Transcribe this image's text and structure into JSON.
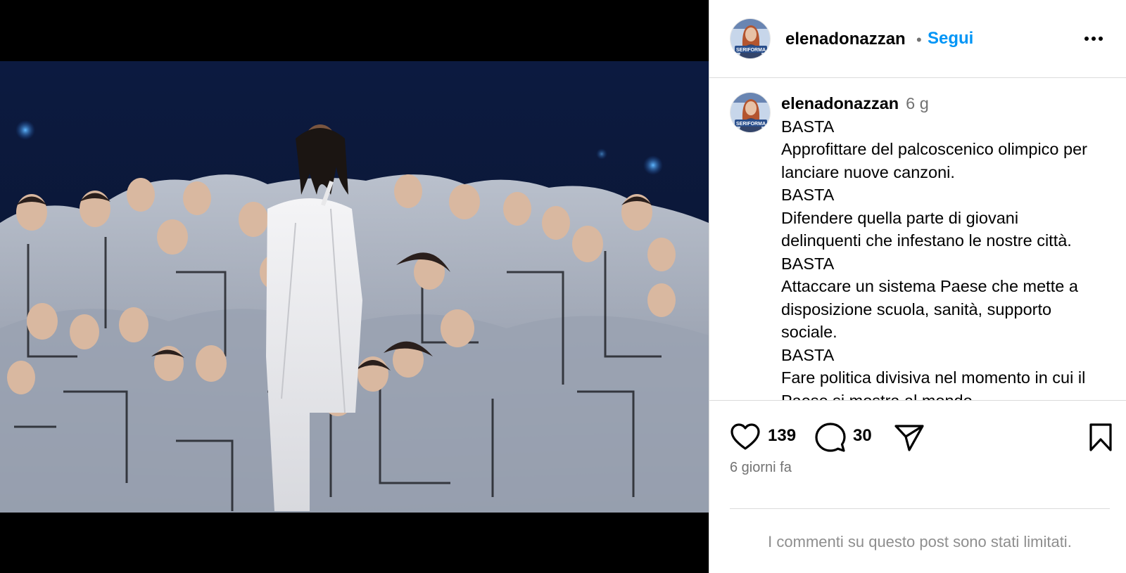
{
  "header": {
    "username": "elenadonazzan",
    "separator": "•",
    "follow_label": "Segui",
    "more_icon": "more-horizontal-icon"
  },
  "caption": {
    "username": "elenadonazzan",
    "time": "6 g",
    "lines": [
      "BASTA",
      "Approfittare del palcoscenico olimpico per",
      "lanciare nuove canzoni.",
      "BASTA",
      "Difendere quella parte di giovani",
      "delinquenti che infestano le nostre città.",
      "BASTA",
      "Attaccare un sistema Paese che mette a",
      "disposizione scuola, sanità, supporto",
      "sociale.",
      "BASTA",
      "Fare politica divisiva nel momento in cui il",
      "Paese si mostra al mondo."
    ]
  },
  "avatar": {
    "badge_text": "SERIFORMA",
    "colors": {
      "bg": "#c7d6ea",
      "hair": "#b4552f",
      "badge": "#2a4f8c"
    }
  },
  "actions": {
    "like_icon": "heart-icon",
    "like_count": "139",
    "comment_icon": "comment-icon",
    "comment_count": "30",
    "share_icon": "send-icon",
    "save_icon": "bookmark-icon"
  },
  "date_label": "6 giorni fa",
  "comments_notice": "I commenti su questo post sono stati limitati.",
  "colors": {
    "link_blue": "#0095f6",
    "secondary_text": "#737373",
    "divider": "#dbdbdb"
  }
}
